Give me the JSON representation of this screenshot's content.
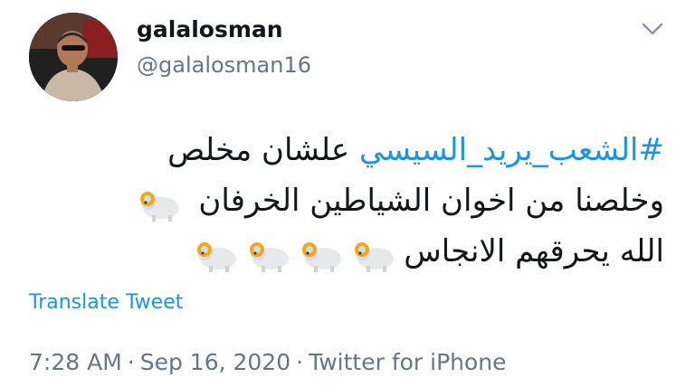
{
  "author": {
    "display_name": "galalosman",
    "handle": "@galalosman16"
  },
  "icons": {
    "menu": "chevron-down-icon",
    "emoji": "ram-emoji"
  },
  "tweet": {
    "line1_hashtag": "#الشعب_يريد_السيسي",
    "line1_text": " علشان مخلص",
    "line2_text": "وخلصنا من اخوان الشياطين الخرفان ",
    "line3_text": "الله يحرقهم الانجاس"
  },
  "translate_label": "Translate Tweet",
  "meta": {
    "time": "7:28 AM",
    "separator": "·",
    "date": "Sep 16, 2020",
    "source": "Twitter for iPhone"
  },
  "colors": {
    "link": "#1b95e0",
    "secondary": "#657786",
    "text": "#14171a"
  }
}
